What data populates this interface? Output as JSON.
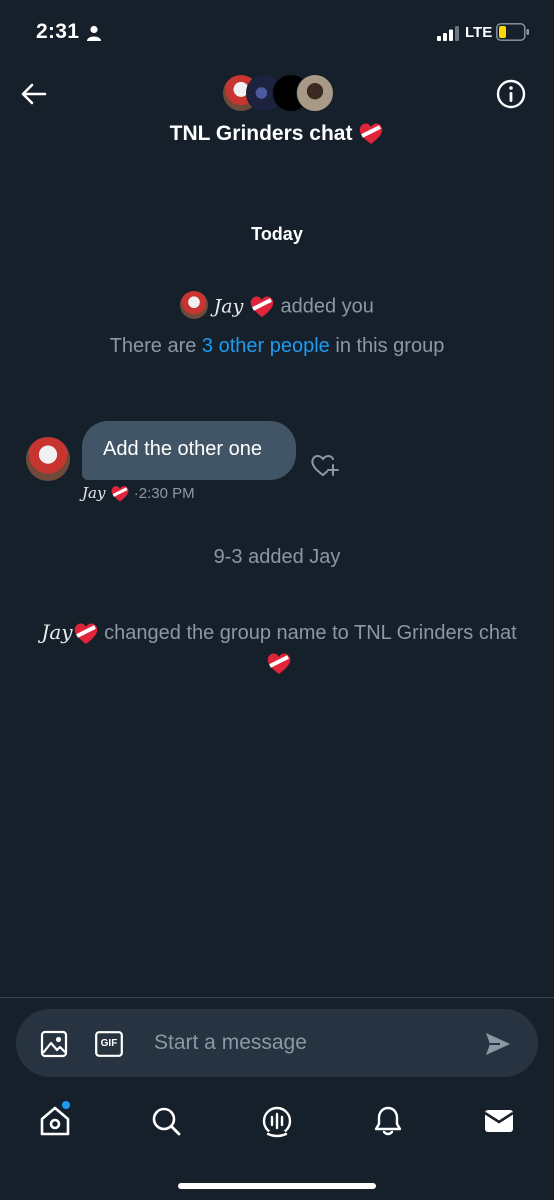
{
  "status_bar": {
    "time": "2:31",
    "network": "LTE",
    "icons": [
      "person-icon",
      "signal-icon",
      "battery-icon"
    ]
  },
  "header": {
    "title": "TNL Grinders chat",
    "title_emoji": "heart-ribbon-icon",
    "back_icon": "arrow-left-icon",
    "info_icon": "info-icon"
  },
  "conversation": {
    "date_divider": "Today",
    "added_you": {
      "name": "Jay",
      "text": "added you"
    },
    "people_notice": {
      "before": "There are",
      "link": "3 other people",
      "after": "in this group"
    },
    "message": {
      "text": "Add the other one",
      "sender": "Jay",
      "time": "·2:30 PM"
    },
    "jay_added": "9-3 added Jay",
    "name_change": {
      "name": "Jay",
      "text": "changed the group name to TNL Grinders chat"
    }
  },
  "composer": {
    "placeholder": "Start a message",
    "gif_label": "GIF"
  },
  "bottom_nav": [
    "home-icon",
    "search-icon",
    "spaces-icon",
    "notifications-icon",
    "messages-icon"
  ],
  "colors": {
    "background": "#15202b",
    "accent": "#1d9bf0",
    "bubble": "#425566",
    "muted": "#8b98a5"
  }
}
